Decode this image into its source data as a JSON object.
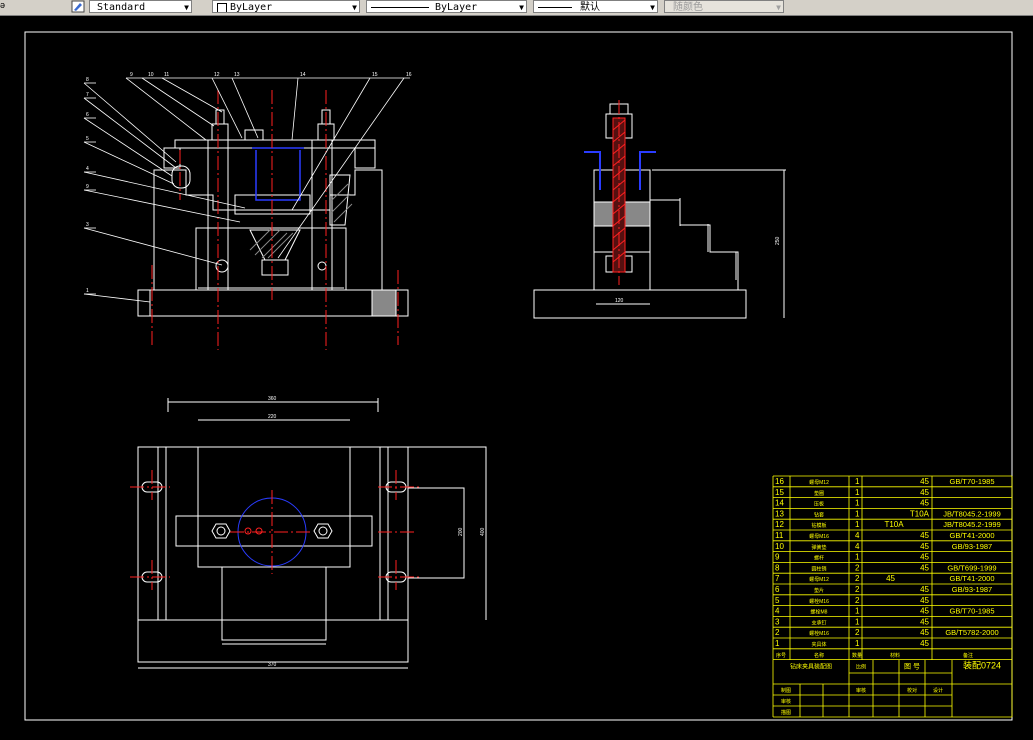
{
  "toolbar": {
    "textstyle_value": "Standard",
    "layer_value": "ByLayer",
    "linetype_value": "ByLayer",
    "lineweight_value": "默认",
    "plotstyle_value": "随颜色"
  },
  "colors": {
    "background": "#000000",
    "line": "#ffffff",
    "center": "#ff0000",
    "hidden": "#0000ff",
    "title": "#ffff00",
    "hatch": "#ff0000"
  },
  "drawing": {
    "front_view_balloons": [
      "8",
      "7",
      "6",
      "5",
      "4",
      "9",
      "3",
      "1",
      "9",
      "10",
      "11",
      "12",
      "13",
      "14",
      "15",
      "16"
    ],
    "dims": {
      "top_width": "360",
      "inner_width": "220",
      "bottom_width": "370",
      "overall_height": "400",
      "inner_height": "200",
      "side_height": "250",
      "side_base": "120"
    }
  },
  "bom": {
    "rows": [
      {
        "no": "16",
        "name": "螺母M12",
        "qty": "1",
        "mat": "45",
        "std": "GB/T70-1985"
      },
      {
        "no": "15",
        "name": "垫圈",
        "qty": "1",
        "mat": "45",
        "std": ""
      },
      {
        "no": "14",
        "name": "压板",
        "qty": "1",
        "mat": "45",
        "std": ""
      },
      {
        "no": "13",
        "name": "钻套",
        "qty": "1",
        "mat": "T10A",
        "std": "JB/T8045.2-1999"
      },
      {
        "no": "12",
        "name": "钻模板",
        "qty": "1",
        "mat": "T10A",
        "std": "JB/T8045.2-1999"
      },
      {
        "no": "11",
        "name": "螺母M16",
        "qty": "4",
        "mat": "45",
        "std": "GB/T41-2000"
      },
      {
        "no": "10",
        "name": "弹簧垫",
        "qty": "4",
        "mat": "45",
        "std": "GB/93-1987"
      },
      {
        "no": "9",
        "name": "螺杆",
        "qty": "1",
        "mat": "45",
        "std": ""
      },
      {
        "no": "8",
        "name": "圆柱销",
        "qty": "2",
        "mat": "45",
        "std": "GB/T699-1999"
      },
      {
        "no": "7",
        "name": "螺母M12",
        "qty": "2",
        "mat": "45",
        "std": "GB/T41-2000"
      },
      {
        "no": "6",
        "name": "垫片",
        "qty": "2",
        "mat": "45",
        "std": "GB/93-1987"
      },
      {
        "no": "5",
        "name": "螺栓M16",
        "qty": "2",
        "mat": "45",
        "std": ""
      },
      {
        "no": "4",
        "name": "螺栓M8",
        "qty": "1",
        "mat": "45",
        "std": "GB/T70-1985"
      },
      {
        "no": "3",
        "name": "支承钉",
        "qty": "1",
        "mat": "45",
        "std": ""
      },
      {
        "no": "2",
        "name": "螺栓M16",
        "qty": "2",
        "mat": "45",
        "std": "GB/T5782-2000"
      },
      {
        "no": "1",
        "name": "夹具体",
        "qty": "1",
        "mat": "45",
        "std": ""
      }
    ],
    "header": {
      "no": "序号",
      "name": "名称",
      "qty": "数量",
      "mat": "材料",
      "std": "备注"
    },
    "title_name": "钻床夹具装配图",
    "scale_label": "比例",
    "sheet_label": "图 号",
    "drawing_no": "装配0724",
    "rows_labels": [
      "制图",
      "审核",
      "描图",
      "审核",
      "校对",
      "设计"
    ]
  }
}
